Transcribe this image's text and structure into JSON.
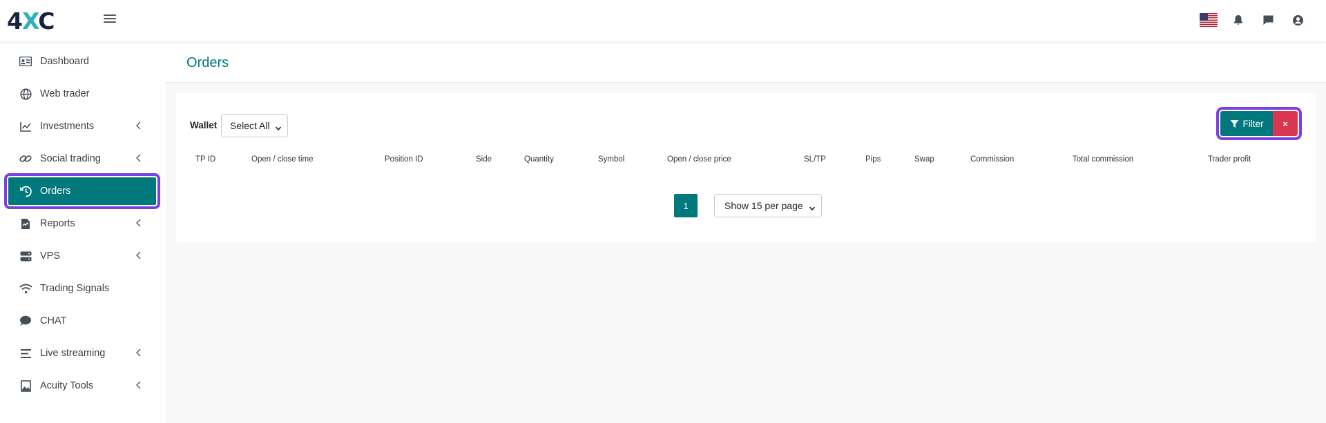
{
  "brand": {
    "logo_prefix": "4",
    "logo_x": "X",
    "logo_suffix": "C"
  },
  "colors": {
    "primary": "#00787c",
    "danger": "#d93652",
    "highlight": "#7b3fe4",
    "logo_dark": "#17223b",
    "logo_accent": "#2cb1b9"
  },
  "header": {
    "icons": [
      "us-flag-icon",
      "bell-icon",
      "chat-bubble-icon",
      "user-circle-icon"
    ]
  },
  "sidebar": {
    "items": [
      {
        "label": "Dashboard",
        "icon": "id-card-icon",
        "has_submenu": false
      },
      {
        "label": "Web trader",
        "icon": "globe-icon",
        "has_submenu": false
      },
      {
        "label": "Investments",
        "icon": "line-chart-icon",
        "has_submenu": true
      },
      {
        "label": "Social trading",
        "icon": "link-icon",
        "has_submenu": true
      },
      {
        "label": "Orders",
        "icon": "history-icon",
        "has_submenu": false,
        "active": true
      },
      {
        "label": "Reports",
        "icon": "report-file-icon",
        "has_submenu": true
      },
      {
        "label": "VPS",
        "icon": "server-icon",
        "has_submenu": true
      },
      {
        "label": "Trading Signals",
        "icon": "wifi-icon",
        "has_submenu": false
      },
      {
        "label": "CHAT",
        "icon": "comment-icon",
        "has_submenu": false
      },
      {
        "label": "Live streaming",
        "icon": "stream-lines-icon",
        "has_submenu": true
      },
      {
        "label": "Acuity Tools",
        "icon": "image-chart-icon",
        "has_submenu": true
      }
    ]
  },
  "page": {
    "title": "Orders"
  },
  "filters": {
    "wallet_label": "Wallet",
    "wallet_value": "Select All",
    "filter_button": "Filter",
    "clear_button": "×"
  },
  "table": {
    "columns": [
      "TP ID",
      "Open / close time",
      "Position ID",
      "Side",
      "Quantity",
      "Symbol",
      "Open / close price",
      "SL/TP",
      "Pips",
      "Swap",
      "Commission",
      "Total commission",
      "Trader profit"
    ]
  },
  "pagination": {
    "current_page": "1",
    "per_page": "Show 15 per page"
  }
}
